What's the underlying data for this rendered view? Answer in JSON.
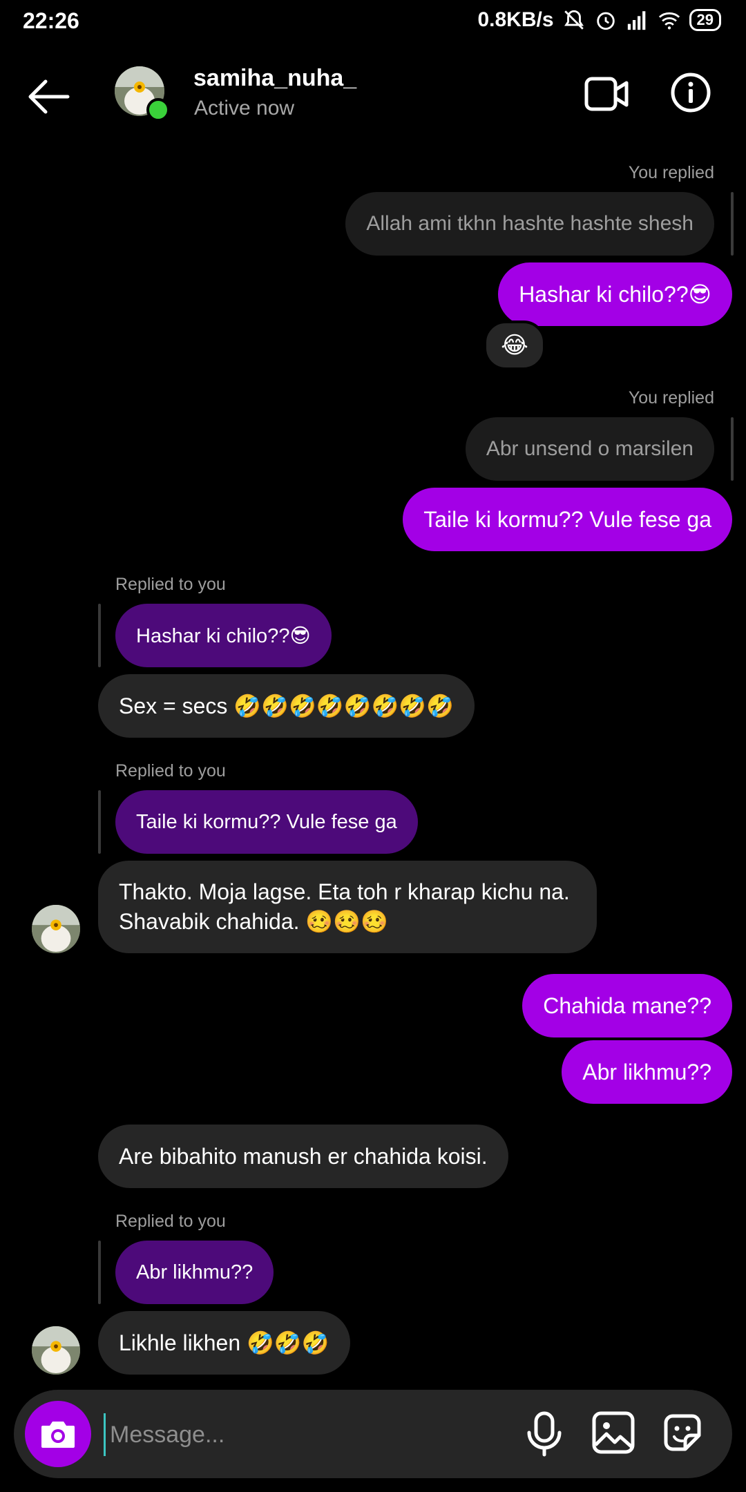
{
  "status_bar": {
    "time": "22:26",
    "net_speed": "0.8KB/s",
    "battery": "29",
    "icons": [
      "mute-bell-icon",
      "alarm-icon",
      "signal-icon",
      "wifi-icon",
      "battery-icon"
    ]
  },
  "header": {
    "username": "samiha_nuha_",
    "status": "Active now",
    "icons": [
      "back-arrow-icon",
      "video-call-icon",
      "info-icon"
    ]
  },
  "messages": {
    "m1": {
      "label": "You replied",
      "quoted": "Allah ami tkhn hashte hashte shesh",
      "text": "Hashar ki chilo??😎",
      "reaction": "😂"
    },
    "m2": {
      "label": "You replied",
      "quoted": "Abr unsend o marsilen",
      "text": "Taile ki kormu?? Vule fese ga"
    },
    "m3": {
      "label": "Replied to you",
      "quoted": "Hashar ki chilo??😎",
      "text": "Sex = secs 🤣🤣🤣🤣🤣🤣🤣🤣"
    },
    "m4": {
      "label": "Replied to you",
      "quoted": "Taile ki kormu?? Vule fese ga",
      "text": "Thakto. Moja lagse. Eta toh r kharap kichu na. Shavabik chahida. 🥴🥴🥴"
    },
    "m5": {
      "text": "Chahida mane??"
    },
    "m6": {
      "text": "Abr likhmu??"
    },
    "m7": {
      "text": "Are bibahito manush er chahida koisi."
    },
    "m8": {
      "label": "Replied to you",
      "quoted": "Abr likhmu??",
      "text": "Likhle likhen 🤣🤣🤣"
    }
  },
  "composer": {
    "placeholder": "Message...",
    "icons": [
      "camera-icon",
      "microphone-icon",
      "gallery-icon",
      "sticker-icon"
    ]
  },
  "colors": {
    "sent_bubble": "#a300e6",
    "received_bubble": "#262626",
    "quoted_sent": "#4d0a7a",
    "online": "#3ad13a"
  }
}
